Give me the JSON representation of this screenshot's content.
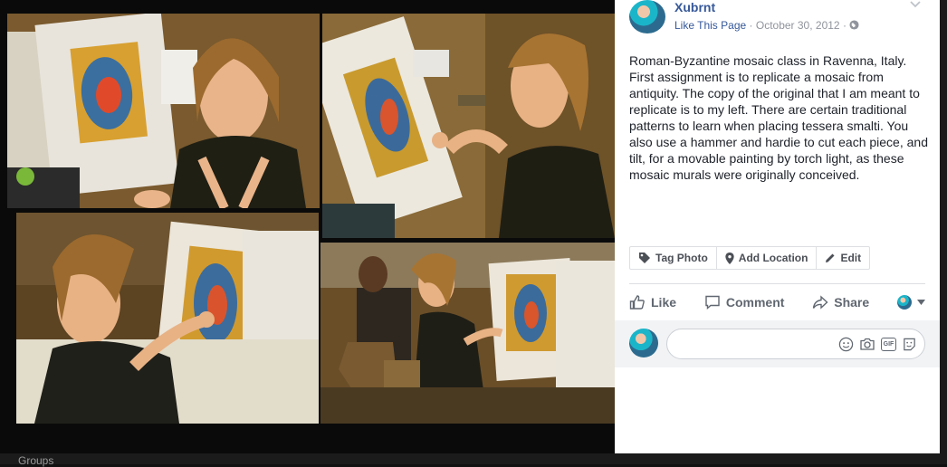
{
  "post": {
    "page_name": "Xubrnt",
    "like_page": "Like This Page",
    "separator": "·",
    "date": "October 30, 2012",
    "caption": "Roman-Byzantine mosaic class in Ravenna, Italy. First assignment is to replicate a mosaic from antiquity. The copy of the original that I am meant to replicate is to my left. There are certain traditional patterns to learn when placing tessera smalti. You also use a hammer and hardie to cut each piece, and tilt, for a movable painting by torch light, as these mosaic murals were originally conceived."
  },
  "photo_actions": [
    {
      "label": "Tag Photo",
      "icon": "tag-icon"
    },
    {
      "label": "Add Location",
      "icon": "location-pin-icon"
    },
    {
      "label": "Edit",
      "icon": "pencil-icon"
    }
  ],
  "post_actions": [
    {
      "label": "Like",
      "icon": "thumbs-up-icon"
    },
    {
      "label": "Comment",
      "icon": "comment-icon"
    },
    {
      "label": "Share",
      "icon": "share-icon"
    }
  ],
  "comment_input": {
    "icons": [
      "emoji-icon",
      "camera-icon",
      "gif-icon",
      "sticker-icon"
    ],
    "gif_label": "GIF"
  },
  "sidebar": {
    "groups_label": "Groups"
  },
  "colors": {
    "link": "#365899",
    "muted": "#90949c",
    "action_text": "#606770"
  }
}
